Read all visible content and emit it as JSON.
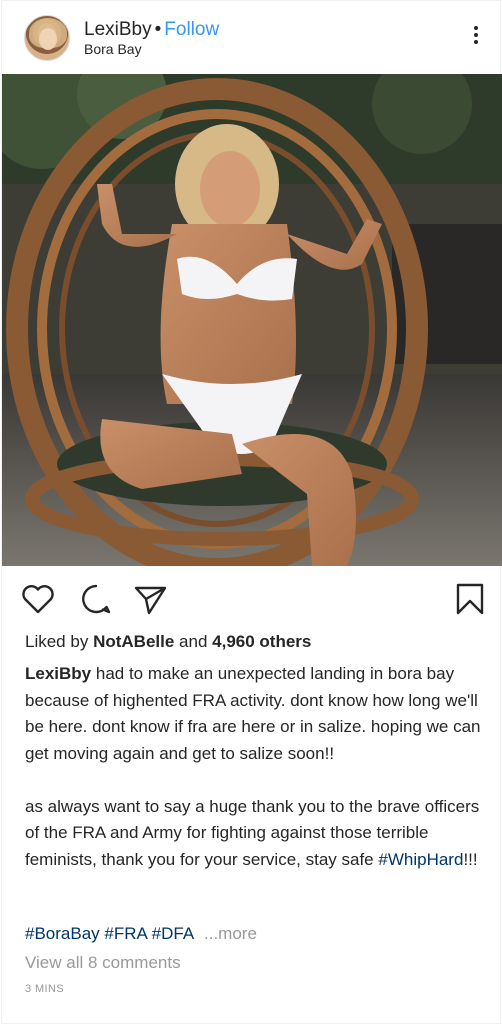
{
  "header": {
    "username": "LexiBby",
    "separator": "•",
    "follow_label": "Follow",
    "location": "Bora Bay",
    "avatar_icon": "profile-avatar",
    "more_icon": "more-options-icon"
  },
  "photo": {
    "description_icon": "post-photo"
  },
  "actions": {
    "like_icon": "heart-icon",
    "comment_icon": "comment-icon",
    "share_icon": "send-icon",
    "save_icon": "bookmark-icon"
  },
  "likes": {
    "prefix": "Liked by",
    "liker": "NotABelle",
    "connector": "and",
    "others": "4,960 others"
  },
  "caption": {
    "username": "LexiBby",
    "paragraph1": "had to make an unexpected landing in bora bay because of highented FRA activity. dont know how long we'll be here. dont know if fra are here or in salize. hoping we can get moving again and get to salize soon!!",
    "paragraph2": "as always want to say a huge thank you to the brave officers of the FRA and Army for fighting against those terrible feminists, thank you for your service, stay safe",
    "hashtag_inline": "#WhipHard",
    "trailing": "!!!"
  },
  "tags": {
    "items": [
      "#BoraBay",
      "#FRA",
      "#DFA"
    ],
    "more_label": "...more"
  },
  "comments": {
    "view_all_label": "View all 8 comments"
  },
  "timestamp": "3 MINS",
  "colors": {
    "link_blue": "#3897f0",
    "hashtag_blue": "#003569",
    "muted_gray": "#999999",
    "text": "#262626"
  }
}
